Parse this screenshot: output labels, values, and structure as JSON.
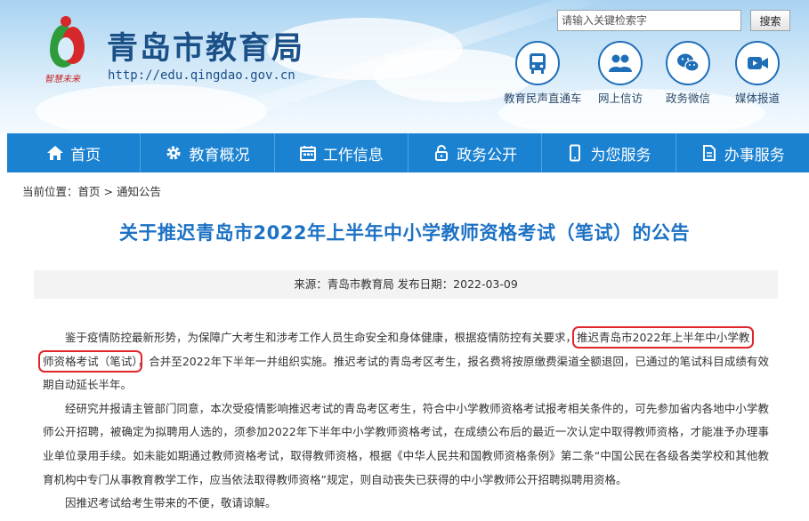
{
  "header": {
    "site_title": "青岛市教育局",
    "site_url": "http://edu.qingdao.gov.cn",
    "search": {
      "placeholder": "请输入关键检索字",
      "button_label": "搜索"
    },
    "quick_links": [
      {
        "label": "教育民声直通车",
        "icon": "bus-icon"
      },
      {
        "label": "网上信访",
        "icon": "people-icon"
      },
      {
        "label": "政务微信",
        "icon": "wechat-icon"
      },
      {
        "label": "媒体报道",
        "icon": "video-icon"
      }
    ]
  },
  "nav": [
    {
      "label": "首页",
      "icon": "home-icon"
    },
    {
      "label": "教育概况",
      "icon": "gear-icon"
    },
    {
      "label": "工作信息",
      "icon": "calendar-icon"
    },
    {
      "label": "政务公开",
      "icon": "lock-icon"
    },
    {
      "label": "为您服务",
      "icon": "phone-icon"
    },
    {
      "label": "办事服务",
      "icon": "document-icon"
    }
  ],
  "breadcrumb": {
    "prefix": "当前位置：",
    "home": "首页",
    "separator": " > ",
    "current": "通知公告"
  },
  "article": {
    "title": "关于推迟青岛市2022年上半年中小学教师资格考试（笔试）的公告",
    "meta": "来源：青岛市教育局 发布日期：2022-03-09",
    "p1_before": "鉴于疫情防控最新形势，为保障广大考生和涉考工作人员生命安全和身体健康，根据疫情防控有关要求，",
    "p1_highlight_a": "推迟青岛市2022年上半年中小学教",
    "p1_highlight_b": "师资格考试（笔试）",
    "p1_after": "，合并至2022年下半年一并组织实施。推迟考试的青岛考区考生，报名费将按原缴费渠道全额退回，已通过的笔试科目成绩有效期自动延长半年。",
    "p2": "经研究并报请主管部门同意，本次受疫情影响推迟考试的青岛考区考生，符合中小学教师资格考试报考相关条件的，可先参加省内各地中小学教师公开招聘，被确定为拟聘用人选的，须参加2022年下半年中小学教师资格考试，在成绩公布后的最近一次认定中取得教师资格，才能准予办理事业单位录用手续。如未能如期通过教师资格考试，取得教师资格，根据《中华人民共和国教师资格条例》第二条“中国公民在各级各类学校和其他教育机构中专门从事教育教学工作，应当依法取得教师资格”规定，则自动丧失已获得的中小学教师公开招聘拟聘用资格。",
    "p3": "因推迟考试给考生带来的不便，敬请谅解。"
  },
  "colors": {
    "nav_bg": "#1b82d2",
    "title_blue": "#1d72c4",
    "site_title": "#1b4f87",
    "highlight": "#e0262a"
  }
}
